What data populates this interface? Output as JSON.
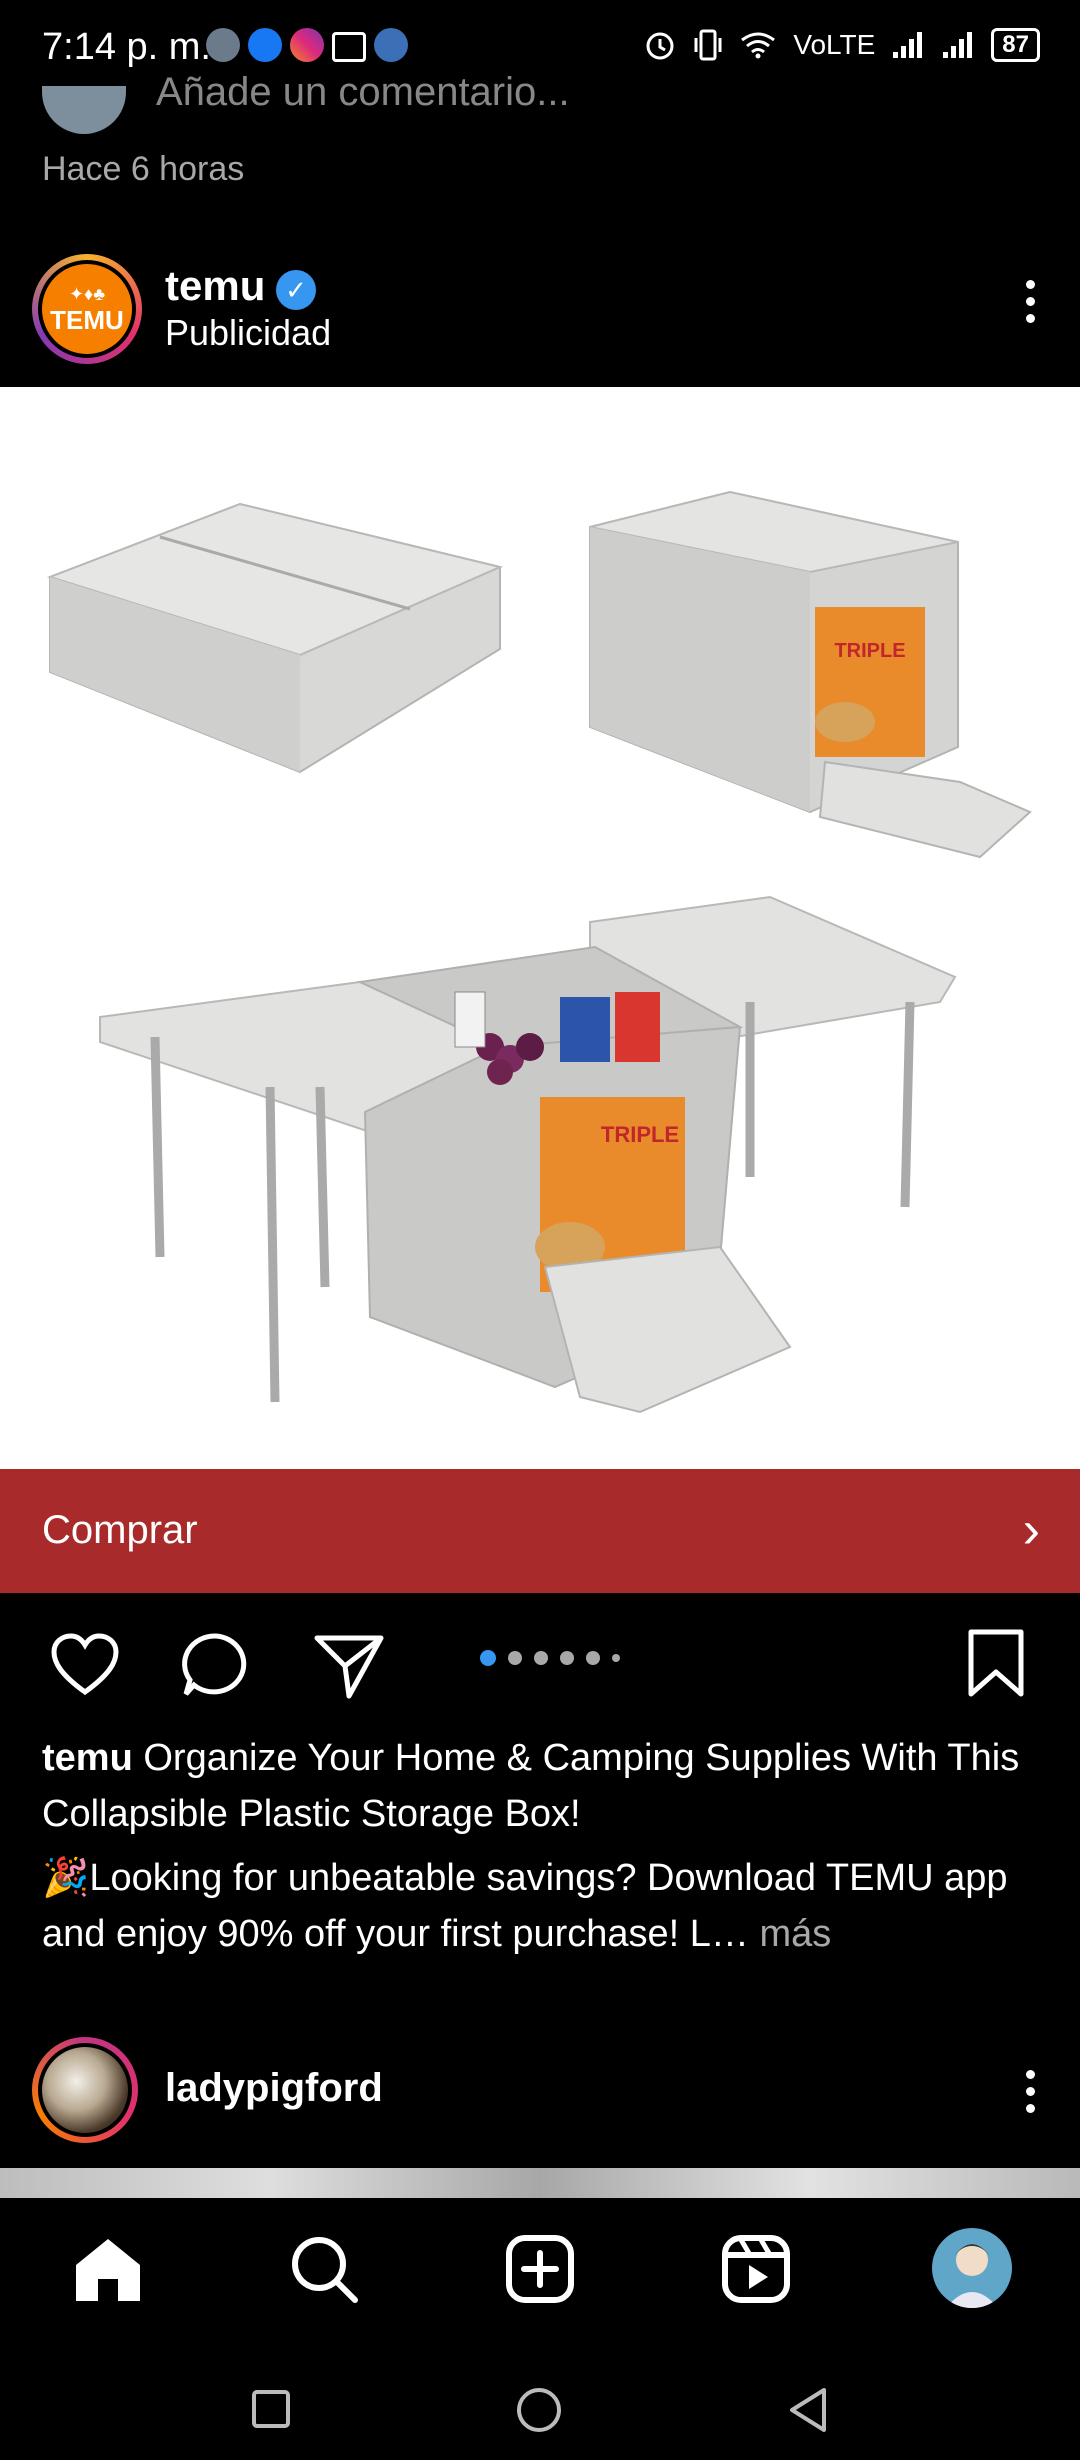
{
  "status_bar": {
    "time": "7:14 p. m.",
    "network": "VoLTE",
    "battery": "87"
  },
  "previous_post": {
    "comment_placeholder": "Añade un comentario...",
    "time_ago": "Hace 6 horas"
  },
  "post": {
    "username": "temu",
    "sponsored_label": "Publicidad",
    "avatar_text": "TEMU",
    "cta_label": "Comprar",
    "carousel_count": 6,
    "carousel_active": 1,
    "caption_username": "temu",
    "caption_text": "Organize Your Home & Camping Supplies With This Collapsible Plastic Storage Box!",
    "caption_extra": "🎉Looking for unbeatable savings? Download TEMU app and enjoy 90% off your first purchase! L…",
    "more_label": "más",
    "product_text": "TRIPLE"
  },
  "suggested_post": {
    "username": "ladypigford"
  },
  "colors": {
    "cta_bg": "#a82a2a",
    "verified": "#3797f0",
    "carousel_active": "#3797f0",
    "temu_orange": "#f77f00"
  },
  "icons": {
    "like": "heart-icon",
    "comment": "comment-icon",
    "share": "send-icon",
    "save": "bookmark-icon",
    "home": "home-icon",
    "search": "search-icon",
    "create": "plus-square-icon",
    "reels": "reels-icon",
    "back": "back-triangle-icon",
    "home_sys": "circle-home-icon",
    "recents": "square-recents-icon"
  }
}
